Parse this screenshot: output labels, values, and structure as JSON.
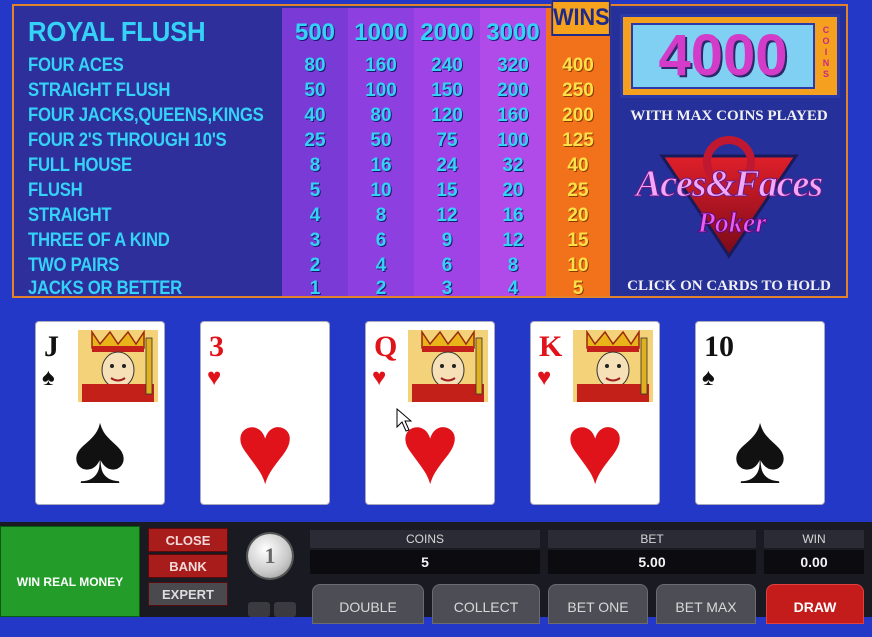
{
  "paytable": {
    "wins_label": "WINS",
    "bet_headers": [
      "500",
      "1000",
      "2000",
      "3000"
    ],
    "rows": [
      {
        "hand": "ROYAL FLUSH",
        "payouts": [
          "500",
          "1000",
          "2000",
          "3000",
          ""
        ]
      },
      {
        "hand": "FOUR ACES",
        "payouts": [
          "80",
          "160",
          "240",
          "320",
          "400"
        ]
      },
      {
        "hand": "STRAIGHT FLUSH",
        "payouts": [
          "50",
          "100",
          "150",
          "200",
          "250"
        ]
      },
      {
        "hand": "FOUR JACKS,QUEENS,KINGS",
        "payouts": [
          "40",
          "80",
          "120",
          "160",
          "200"
        ]
      },
      {
        "hand": "FOUR 2'S THROUGH 10'S",
        "payouts": [
          "25",
          "50",
          "75",
          "100",
          "125"
        ]
      },
      {
        "hand": "FULL HOUSE",
        "payouts": [
          "8",
          "16",
          "24",
          "32",
          "40"
        ]
      },
      {
        "hand": "FLUSH",
        "payouts": [
          "5",
          "10",
          "15",
          "20",
          "25"
        ]
      },
      {
        "hand": "STRAIGHT",
        "payouts": [
          "4",
          "8",
          "12",
          "16",
          "20"
        ]
      },
      {
        "hand": "THREE OF A KIND",
        "payouts": [
          "3",
          "6",
          "9",
          "12",
          "15"
        ]
      },
      {
        "hand": "TWO PAIRS",
        "payouts": [
          "2",
          "4",
          "6",
          "8",
          "10"
        ]
      },
      {
        "hand": "JACKS OR BETTER",
        "payouts": [
          "1",
          "2",
          "3",
          "4",
          "5"
        ]
      }
    ]
  },
  "promo": {
    "max_win": "4000",
    "coins_word": "COINS",
    "max_coins_text": "WITH MAX COINS PLAYED",
    "logo_line1": "Aces&Faces",
    "logo_line2": "Poker",
    "hold_text": "CLICK ON CARDS TO HOLD"
  },
  "cards": [
    {
      "rank": "J",
      "suit": "♠",
      "color": "black",
      "face": true
    },
    {
      "rank": "3",
      "suit": "♥",
      "color": "red",
      "face": false
    },
    {
      "rank": "Q",
      "suit": "♥",
      "color": "red",
      "face": true
    },
    {
      "rank": "K",
      "suit": "♥",
      "color": "red",
      "face": true
    },
    {
      "rank": "10",
      "suit": "♠",
      "color": "black",
      "face": false
    }
  ],
  "controls": {
    "real_money": "WIN REAL MONEY",
    "close": "CLOSE",
    "bank": "BANK",
    "expert": "EXPERT",
    "coin_value": "1",
    "coins_label": "COINS",
    "coins_value": "5",
    "bet_label": "BET",
    "bet_value": "5.00",
    "win_label": "WIN",
    "win_value": "0.00",
    "double": "DOUBLE",
    "collect": "COLLECT",
    "bet_one": "BET ONE",
    "bet_max": "BET MAX",
    "draw": "DRAW"
  },
  "colors": {
    "background": "#2438c8",
    "paytable_text": "#35d2f8",
    "wins_column": "#f2721c",
    "draw_button": "#c41b1b",
    "real_money_button": "#239c2a"
  }
}
